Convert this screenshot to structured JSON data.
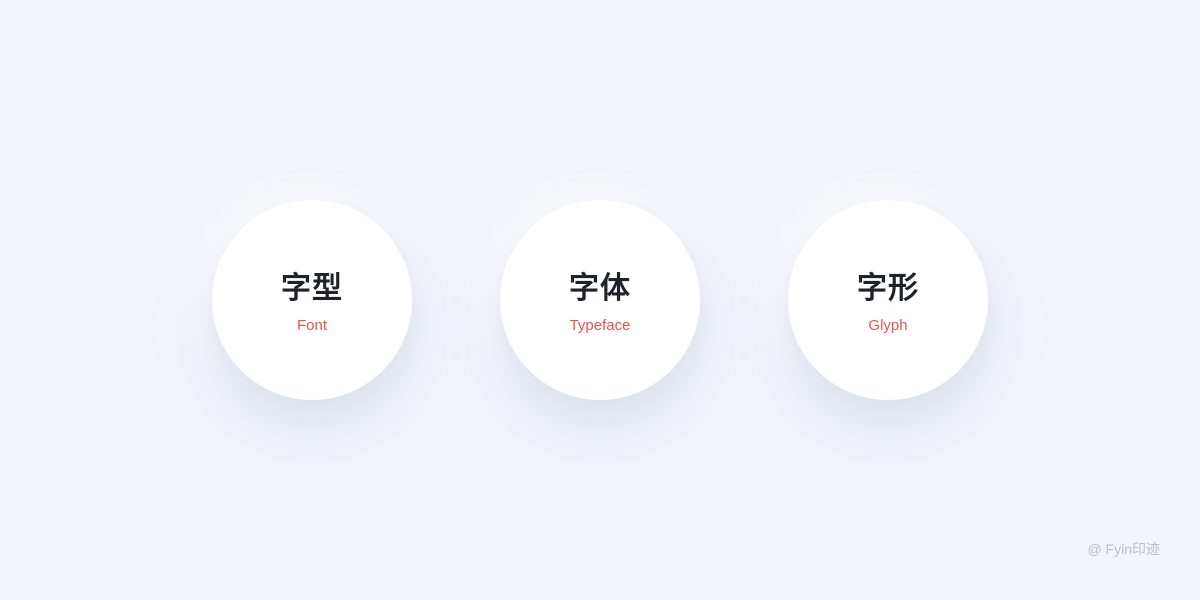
{
  "colors": {
    "background": "#f1f4fa",
    "circle": "#ffffff",
    "term_zh": "#1f2329",
    "term_en": "#e3564f",
    "watermark": "#b9bec7"
  },
  "terms": [
    {
      "zh": "字型",
      "en": "Font"
    },
    {
      "zh": "字体",
      "en": "Typeface"
    },
    {
      "zh": "字形",
      "en": "Glyph"
    }
  ],
  "watermark": "@ Fyin印迹"
}
